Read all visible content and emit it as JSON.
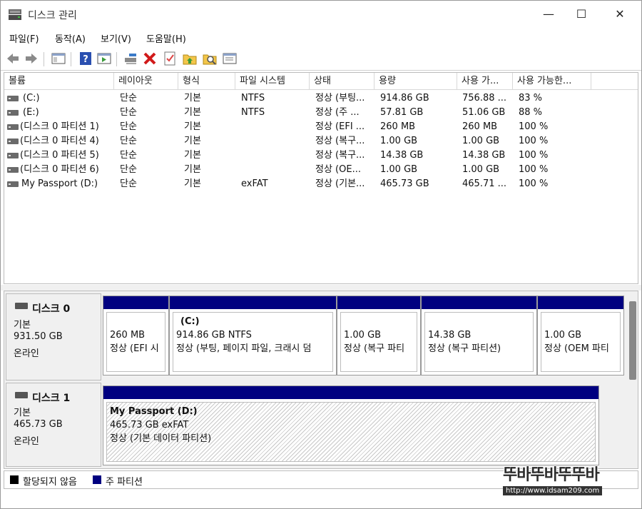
{
  "window": {
    "title": "디스크 관리",
    "minimize": "—",
    "maximize": "☐",
    "close": "✕"
  },
  "menu": [
    "파일(F)",
    "동작(A)",
    "보기(V)",
    "도움말(H)"
  ],
  "toolbar": {
    "icons": [
      "back-arrow-icon",
      "forward-arrow-icon",
      "console-tree-icon",
      "help-icon",
      "show-pane-icon",
      "connect-drive-icon",
      "delete-icon",
      "checklist-icon",
      "folder-up-icon",
      "search-folder-icon",
      "properties-icon"
    ]
  },
  "volume_list": {
    "columns": [
      "볼륨",
      "레이아웃",
      "형식",
      "파일 시스템",
      "상태",
      "용량",
      "사용 가...",
      "사용 가능한..."
    ],
    "rows": [
      {
        "volume": "(C:)",
        "layout": "단순",
        "type": "기본",
        "fs": "NTFS",
        "status": "정상 (부팅...",
        "capacity": "914.86 GB",
        "free": "756.88 ...",
        "pct": "83 %"
      },
      {
        "volume": "(E:)",
        "layout": "단순",
        "type": "기본",
        "fs": "NTFS",
        "status": "정상 (주 ...",
        "capacity": "57.81 GB",
        "free": "51.06 GB",
        "pct": "88 %"
      },
      {
        "volume": "(디스크 0 파티션 1)",
        "layout": "단순",
        "type": "기본",
        "fs": "",
        "status": "정상 (EFI ...",
        "capacity": "260 MB",
        "free": "260 MB",
        "pct": "100 %"
      },
      {
        "volume": "(디스크 0 파티션 4)",
        "layout": "단순",
        "type": "기본",
        "fs": "",
        "status": "정상 (복구...",
        "capacity": "1.00 GB",
        "free": "1.00 GB",
        "pct": "100 %"
      },
      {
        "volume": "(디스크 0 파티션 5)",
        "layout": "단순",
        "type": "기본",
        "fs": "",
        "status": "정상 (복구...",
        "capacity": "14.38 GB",
        "free": "14.38 GB",
        "pct": "100 %"
      },
      {
        "volume": "(디스크 0 파티션 6)",
        "layout": "단순",
        "type": "기본",
        "fs": "",
        "status": "정상 (OE...",
        "capacity": "1.00 GB",
        "free": "1.00 GB",
        "pct": "100 %"
      },
      {
        "volume": "My Passport (D:)",
        "layout": "단순",
        "type": "기본",
        "fs": "exFAT",
        "status": "정상 (기본...",
        "capacity": "465.73 GB",
        "free": "465.71 ...",
        "pct": "100 %"
      }
    ]
  },
  "disks": [
    {
      "name": "디스크 0",
      "kind": "기본",
      "size": "931.50 GB",
      "state": "온라인",
      "partitions": [
        {
          "name": "",
          "line1": "260 MB",
          "line2": "정상 (EFI 시"
        },
        {
          "name": "(C:)",
          "line1": "914.86 GB NTFS",
          "line2": "정상 (부팅, 페이지 파일, 크래시 덤"
        },
        {
          "name": "",
          "line1": "1.00 GB",
          "line2": "정상 (복구 파티"
        },
        {
          "name": "",
          "line1": "14.38 GB",
          "line2": "정상 (복구 파티션)"
        },
        {
          "name": "",
          "line1": "1.00 GB",
          "line2": "정상 (OEM 파티"
        }
      ]
    },
    {
      "name": "디스크 1",
      "kind": "기본",
      "size": "465.73 GB",
      "state": "온라인",
      "partitions": [
        {
          "name": "My Passport  (D:)",
          "line1": "465.73 GB exFAT",
          "line2": "정상 (기본 데이터 파티션)"
        }
      ]
    }
  ],
  "legend": {
    "unallocated": "할당되지 않음",
    "primary": "주 파티션",
    "unallocated_color": "#000000",
    "primary_color": "#000080"
  },
  "watermark": {
    "line1": "뚜바뚜바뚜뚜바",
    "line2": "http://www.idsam209.com"
  }
}
